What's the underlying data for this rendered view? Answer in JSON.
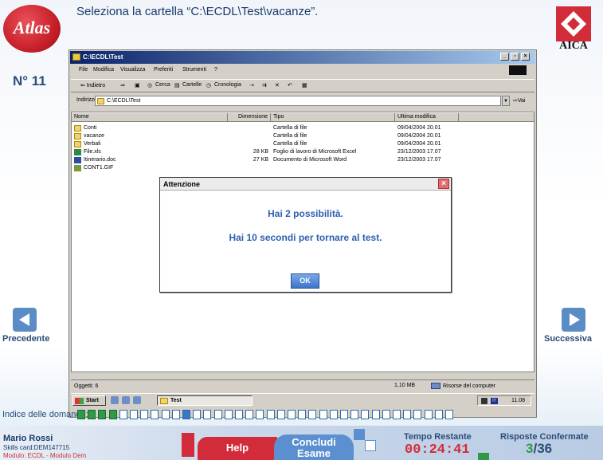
{
  "header": {
    "logo_text": "Atlas",
    "question": "Seleziona la cartella “C:\\ECDL\\Test\\vacanze”.",
    "question_number": "N° 11",
    "aica_label": "AICA"
  },
  "explorer": {
    "title": "C:\\ECDL\\Test",
    "menu": [
      "File",
      "Modifica",
      "Visualizza",
      "Preferiti",
      "Strumenti",
      "?"
    ],
    "toolbar": {
      "back": "⇐ Indietro",
      "forward": "⇒",
      "search": "Cerca",
      "folders": "Cartelle",
      "history": "Cronologia"
    },
    "address_label": "Indirizzo",
    "address_value": "C:\\ECDL\\Test",
    "go_label": "Vai",
    "columns": [
      "Nome",
      "Dimensione",
      "Tipo",
      "Ultima modifica"
    ],
    "files": [
      {
        "name": "Conti",
        "size": "",
        "type": "Cartella di file",
        "modified": "09/04/2004 20.01",
        "icon": "folder"
      },
      {
        "name": "vacanze",
        "size": "",
        "type": "Cartella di file",
        "modified": "09/04/2004 20.01",
        "icon": "folder"
      },
      {
        "name": "Verbali",
        "size": "",
        "type": "Cartella di file",
        "modified": "09/04/2004 20.01",
        "icon": "folder"
      },
      {
        "name": "File.xls",
        "size": "28 KB",
        "type": "Foglio di lavoro di Microsoft Excel",
        "modified": "23/12/2003 17.07",
        "icon": "xls"
      },
      {
        "name": "Itinerario.doc",
        "size": "27 KB",
        "type": "Documento di Microsoft Word",
        "modified": "23/12/2003 17.07",
        "icon": "doc"
      },
      {
        "name": "CONT1.GIF",
        "size": "",
        "type": "",
        "modified": "",
        "icon": "gif"
      }
    ],
    "status_count": "Oggetti: 6",
    "status_size": "1,10 MB",
    "status_location": "Risorse del computer"
  },
  "taskbar": {
    "start_label": "Start",
    "task_label": "Test",
    "language": "IT",
    "clock": "11.08"
  },
  "dialog": {
    "title": "Attenzione",
    "close": "×",
    "message1": "Hai 2 possibilità.",
    "message2": "Hai 10 secondi per tornare al test.",
    "ok_label": "OK"
  },
  "navigation": {
    "prev_label": "Precedente",
    "next_label": "Successiva"
  },
  "question_index": {
    "label": "Indice delle domande:",
    "total": 36,
    "done": [
      1,
      2,
      3,
      4
    ],
    "current": 11
  },
  "footer": {
    "user_name": "Mario Rossi",
    "skills_card": "Skills card:DEM147715",
    "module": "Modulo: ECDL - Modulo Dem",
    "help_label": "Help",
    "conclude_line1": "Concludi",
    "conclude_line2": "Esame",
    "time_label": "Tempo Restante",
    "time_value": "00:24:41",
    "answers_label": "Risposte Confermate",
    "answers_done": "3",
    "answers_total": "/36"
  },
  "colors": {
    "accent_red": "#d22c3a",
    "accent_blue": "#5b8fd0",
    "done_green": "#2e9a46",
    "dialog_text": "#2f5fae"
  }
}
